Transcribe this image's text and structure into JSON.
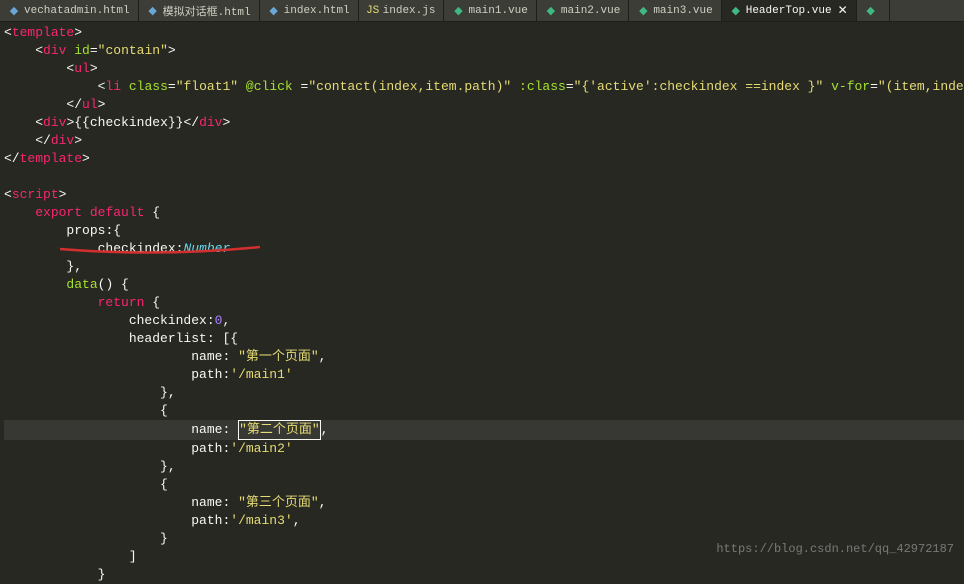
{
  "tabs": [
    {
      "label": "vechatadmin.html",
      "icon": "html"
    },
    {
      "label": "模拟对话框.html",
      "icon": "html"
    },
    {
      "label": "index.html",
      "icon": "html"
    },
    {
      "label": "index.js",
      "icon": "js"
    },
    {
      "label": "main1.vue",
      "icon": "vue"
    },
    {
      "label": "main2.vue",
      "icon": "vue"
    },
    {
      "label": "main3.vue",
      "icon": "vue"
    },
    {
      "label": "HeaderTop.vue",
      "icon": "vue",
      "active": true,
      "closable": true
    }
  ],
  "code": {
    "l1": {
      "t1": "template"
    },
    "l2": {
      "t1": "div",
      "a1": "id",
      "v1": "\"contain\""
    },
    "l3": {
      "t1": "ul"
    },
    "l4": {
      "t1": "li",
      "a1": "class",
      "v1": "\"float1\"",
      "a2": "@click",
      "v2": "\"contact(index,item.path)\"",
      "a3": ":class",
      "v3": "\"{'active':checkindex ==index }\"",
      "a4": "v-for",
      "v4": "\"(item,index"
    },
    "l5": {
      "t1": "ul"
    },
    "l6": {
      "t1": "div",
      "expr": "{{checkindex}}",
      "t2": "div"
    },
    "l7": {
      "t1": "div"
    },
    "l8": {
      "t1": "template"
    },
    "l10": {
      "t1": "script"
    },
    "l11": {
      "k1": "export",
      "k2": "default",
      "b": "{"
    },
    "l12": {
      "p": "props",
      "b": ":{"
    },
    "l13": {
      "p": "checkindex",
      "c": ":",
      "t": "Number"
    },
    "l14": {
      "b": "},"
    },
    "l15": {
      "f": "data",
      "p": "() {"
    },
    "l16": {
      "k": "return",
      "b": "{"
    },
    "l17": {
      "p": "checkindex",
      "c": ":",
      "n": "0",
      "e": ","
    },
    "l18": {
      "p": "headerlist",
      "v": ": [{"
    },
    "l19": {
      "p": "name",
      "c": ": ",
      "s": "\"第一个页面\"",
      "e": ","
    },
    "l20": {
      "p": "path",
      "c": ":",
      "s": "'/main1'"
    },
    "l21": {
      "b": "},"
    },
    "l22": {
      "b": "{"
    },
    "l23": {
      "p": "name",
      "c": ": ",
      "s": "\"第二个页面\"",
      "e": ","
    },
    "l24": {
      "p": "path",
      "c": ":",
      "s": "'/main2'"
    },
    "l25": {
      "b": "},"
    },
    "l26": {
      "b": "{"
    },
    "l27": {
      "p": "name",
      "c": ": ",
      "s": "\"第三个页面\"",
      "e": ","
    },
    "l28": {
      "p": "path",
      "c": ":",
      "s": "'/main3'",
      "e": ","
    },
    "l29": {
      "b": "}"
    },
    "l30": {
      "b": "]"
    },
    "l31": {
      "b": "}"
    }
  },
  "watermark": "https://blog.csdn.net/qq_42972187"
}
